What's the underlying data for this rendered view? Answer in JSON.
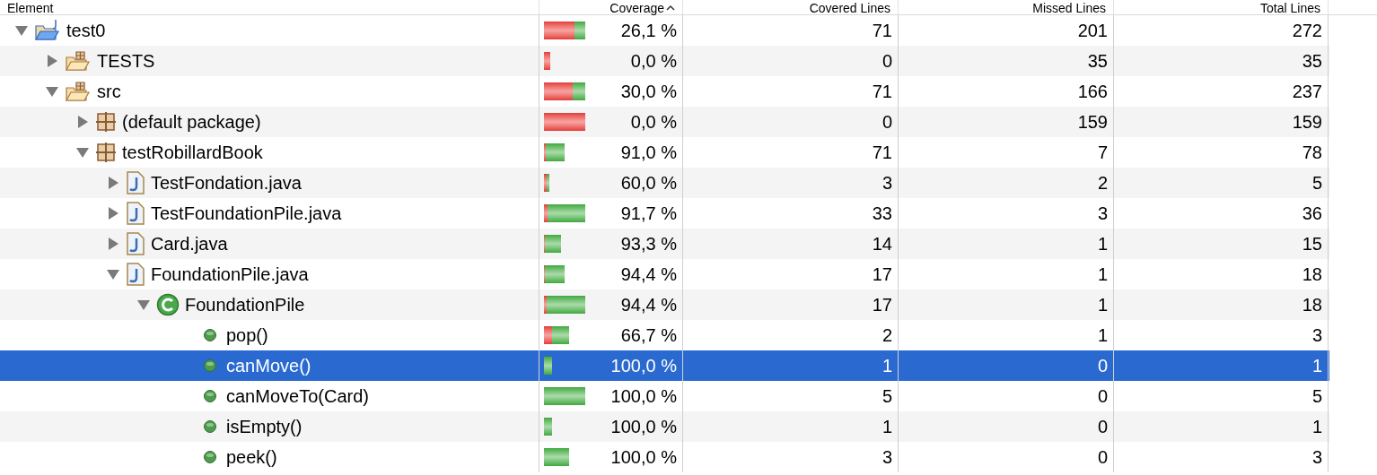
{
  "columns": [
    {
      "label": "Element",
      "sorted": false
    },
    {
      "label": "Coverage",
      "sorted": true
    },
    {
      "label": "Covered Lines",
      "sorted": false
    },
    {
      "label": "Missed Lines",
      "sorted": false
    },
    {
      "label": "Total Lines",
      "sorted": false
    }
  ],
  "rows": [
    {
      "kind": "project",
      "name": "test0",
      "coverage": "26,1 %",
      "covered": "71",
      "missed": "201",
      "total": "272",
      "expanded": true,
      "selected": false,
      "children": [
        {
          "kind": "source-folder",
          "name": "TESTS",
          "coverage": "0,0 %",
          "covered": "0",
          "missed": "35",
          "total": "35",
          "expanded": false,
          "selected": false
        },
        {
          "kind": "source-folder",
          "name": "src",
          "coverage": "30,0 %",
          "covered": "71",
          "missed": "166",
          "total": "237",
          "expanded": true,
          "selected": false,
          "children": [
            {
              "kind": "package",
              "name": "(default package)",
              "coverage": "0,0 %",
              "covered": "0",
              "missed": "159",
              "total": "159",
              "expanded": false,
              "selected": false
            },
            {
              "kind": "package",
              "name": "testRobillardBook",
              "coverage": "91,0 %",
              "covered": "71",
              "missed": "7",
              "total": "78",
              "expanded": true,
              "selected": false,
              "children": [
                {
                  "kind": "java-file",
                  "name": "TestFondation.java",
                  "coverage": "60,0 %",
                  "covered": "3",
                  "missed": "2",
                  "total": "5",
                  "expanded": false,
                  "selected": false
                },
                {
                  "kind": "java-file",
                  "name": "TestFoundationPile.java",
                  "coverage": "91,7 %",
                  "covered": "33",
                  "missed": "3",
                  "total": "36",
                  "expanded": false,
                  "selected": false
                },
                {
                  "kind": "java-file",
                  "name": "Card.java",
                  "coverage": "93,3 %",
                  "covered": "14",
                  "missed": "1",
                  "total": "15",
                  "expanded": false,
                  "selected": false
                },
                {
                  "kind": "java-file",
                  "name": "FoundationPile.java",
                  "coverage": "94,4 %",
                  "covered": "17",
                  "missed": "1",
                  "total": "18",
                  "expanded": true,
                  "selected": false,
                  "children": [
                    {
                      "kind": "class",
                      "name": "FoundationPile",
                      "coverage": "94,4 %",
                      "covered": "17",
                      "missed": "1",
                      "total": "18",
                      "expanded": true,
                      "selected": false,
                      "children": [
                        {
                          "kind": "method",
                          "name": "pop()",
                          "coverage": "66,7 %",
                          "covered": "2",
                          "missed": "1",
                          "total": "3",
                          "selected": false
                        },
                        {
                          "kind": "method",
                          "name": "canMove()",
                          "coverage": "100,0 %",
                          "covered": "1",
                          "missed": "0",
                          "total": "1",
                          "selected": true
                        },
                        {
                          "kind": "method",
                          "name": "canMoveTo(Card)",
                          "coverage": "100,0 %",
                          "covered": "5",
                          "missed": "0",
                          "total": "5",
                          "selected": false
                        },
                        {
                          "kind": "method",
                          "name": "isEmpty()",
                          "coverage": "100,0 %",
                          "covered": "1",
                          "missed": "0",
                          "total": "1",
                          "selected": false
                        },
                        {
                          "kind": "method",
                          "name": "peek()",
                          "coverage": "100,0 %",
                          "covered": "3",
                          "missed": "0",
                          "total": "3",
                          "selected": false
                        }
                      ]
                    }
                  ]
                }
              ]
            }
          ]
        }
      ]
    }
  ]
}
